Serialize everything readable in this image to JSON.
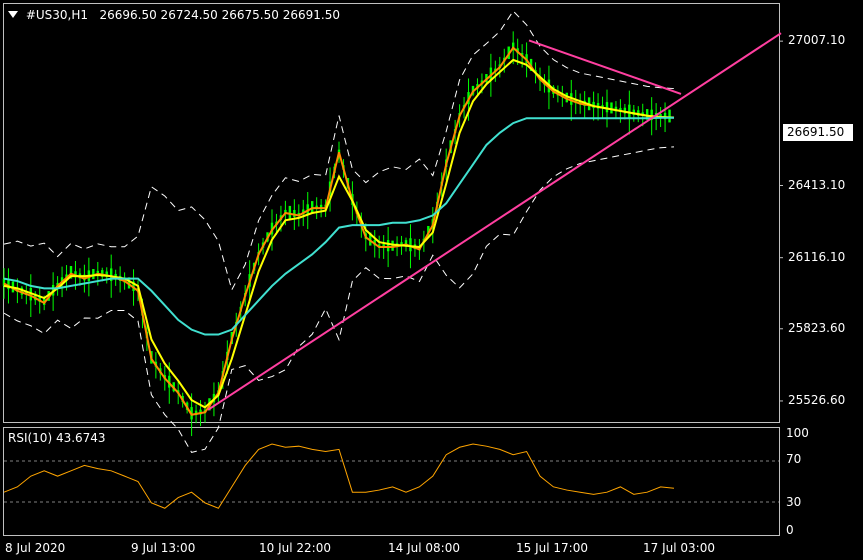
{
  "header": {
    "symbol": "#US30,H1",
    "ohlc": "26696.50 26724.50 26675.50 26691.50"
  },
  "current_price": "26691.50",
  "rsi_label": "RSI(10) 43.6743",
  "colors": {
    "background": "#000000",
    "candles": "#00ff00",
    "ma_fast": "#ff8c00",
    "ma_mid": "#ffff00",
    "ma_slow": "#40e0d0",
    "bands": "#ffffff",
    "trendline": "#ff3fa0",
    "rsi_line": "#ffa500",
    "grid": "#808080"
  },
  "chart_data": [
    {
      "type": "line",
      "title": "#US30,H1",
      "x_ticks": [
        "8 Jul 2020",
        "9 Jul 13:00",
        "10 Jul 22:00",
        "14 Jul 08:00",
        "15 Jul 17:00",
        "17 Jul 03:00"
      ],
      "y_ticks": [
        25526.6,
        25823.6,
        26116.1,
        26413.1,
        27007.1
      ],
      "ylim": [
        25440,
        27160
      ],
      "series": [
        {
          "values": [
            26010,
            25980,
            25960,
            25930,
            26000,
            26050,
            26030,
            26050,
            26040,
            26020,
            25980,
            25700,
            25620,
            25560,
            25470,
            25480,
            25560,
            25780,
            25960,
            26130,
            26230,
            26300,
            26290,
            26320,
            26320,
            26550,
            26350,
            26200,
            26160,
            26160,
            26170,
            26150,
            26250,
            26500,
            26700,
            26800,
            26850,
            26900,
            26980,
            26930,
            26850,
            26800,
            26770,
            26750,
            26740,
            26730,
            26720,
            26710,
            26700,
            26695,
            26692
          ]
        },
        {
          "values": [
            26000,
            25990,
            25970,
            25950,
            25990,
            26040,
            26040,
            26045,
            26040,
            26030,
            26000,
            25780,
            25680,
            25610,
            25530,
            25500,
            25550,
            25700,
            25880,
            26060,
            26190,
            26270,
            26280,
            26300,
            26310,
            26450,
            26350,
            26230,
            26180,
            26170,
            26165,
            26160,
            26220,
            26420,
            26630,
            26760,
            26830,
            26880,
            26930,
            26910,
            26860,
            26810,
            26780,
            26760,
            26740,
            26730,
            26720,
            26710,
            26700,
            26695,
            26693
          ]
        },
        {
          "values": [
            26030,
            26020,
            26000,
            25990,
            25990,
            26000,
            26010,
            26020,
            26030,
            26030,
            26030,
            25980,
            25920,
            25860,
            25820,
            25800,
            25800,
            25820,
            25880,
            25940,
            26000,
            26050,
            26090,
            26130,
            26180,
            26240,
            26250,
            26250,
            26250,
            26260,
            26260,
            26270,
            26290,
            26340,
            26420,
            26500,
            26580,
            26630,
            26670,
            26690,
            26690,
            26690,
            26690,
            26690,
            26690,
            26690,
            26690,
            26690,
            26690,
            26692,
            26692
          ]
        }
      ],
      "trendlines": [
        {
          "from": [
            "9 Jul 13:00",
            25490
          ],
          "to": [
            "17 Jul 03:00",
            27040
          ]
        },
        {
          "from": [
            "15 Jul 17:00",
            27010
          ],
          "to": [
            "17 Jul 03:00",
            26790
          ]
        }
      ]
    },
    {
      "type": "line",
      "title": "RSI(10) 43.6743",
      "y_ticks": [
        0,
        30,
        70,
        100
      ],
      "ylim": [
        0,
        100
      ],
      "levels": [
        30,
        70
      ],
      "series": [
        {
          "values": [
            40,
            45,
            55,
            60,
            55,
            60,
            65,
            62,
            60,
            55,
            50,
            30,
            25,
            35,
            40,
            30,
            25,
            45,
            65,
            80,
            85,
            82,
            83,
            80,
            78,
            80,
            40,
            40,
            42,
            45,
            40,
            45,
            55,
            75,
            82,
            85,
            83,
            80,
            75,
            78,
            55,
            45,
            42,
            40,
            38,
            40,
            45,
            38,
            40,
            45,
            43.7
          ]
        }
      ]
    }
  ]
}
